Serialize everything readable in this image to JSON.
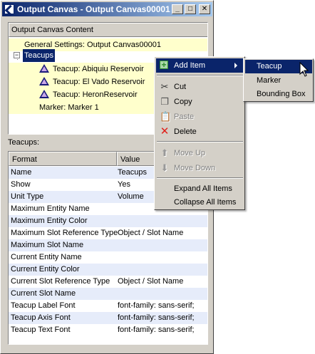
{
  "window": {
    "title": "Output Canvas - Output Canvas00001",
    "minimize_glyph": "_",
    "maximize_glyph": "□",
    "close_glyph": "✕"
  },
  "tree": {
    "header": "Output Canvas Content",
    "general_settings": "General Settings: Output Canvas00001",
    "teacups_node": "Teacups",
    "expander_glyph": "−",
    "teacup_items": [
      "Teacup: Abiquiu Reservoir",
      "Teacup: El Vado Reservoir",
      "Teacup: HeronReservoir"
    ],
    "marker": "Marker: Marker 1"
  },
  "section_label": "Teacups:",
  "table": {
    "col_format": "Format",
    "col_value": "Value",
    "rows": [
      {
        "format": "Name",
        "value": "Teacups"
      },
      {
        "format": "Show",
        "value": "Yes"
      },
      {
        "format": "Unit Type",
        "value": "Volume"
      },
      {
        "format": "Maximum Entity Name",
        "value": ""
      },
      {
        "format": "Maximum Entity Color",
        "value": ""
      },
      {
        "format": "Maximum Slot Reference Type",
        "value": "Object / Slot Name"
      },
      {
        "format": "Maximum Slot Name",
        "value": ""
      },
      {
        "format": "Current Entity Name",
        "value": ""
      },
      {
        "format": "Current Entity Color",
        "value": ""
      },
      {
        "format": "Current Slot Reference Type",
        "value": "Object / Slot Name"
      },
      {
        "format": "Current Slot Name",
        "value": ""
      },
      {
        "format": "Teacup Label Font",
        "value": "font-family: sans-serif;"
      },
      {
        "format": "Teacup Axis Font",
        "value": "font-family: sans-serif;"
      },
      {
        "format": "Teacup Text Font",
        "value": "font-family: sans-serif;"
      }
    ]
  },
  "context_menu": {
    "add_item": "Add Item",
    "cut": "Cut",
    "copy": "Copy",
    "paste": "Paste",
    "delete": "Delete",
    "move_up": "Move Up",
    "move_down": "Move Down",
    "expand_all": "Expand All Items",
    "collapse_all": "Collapse All Items"
  },
  "submenu": {
    "teacup": "Teacup",
    "marker": "Marker",
    "bounding_box": "Bounding Box"
  },
  "colors": {
    "titlebar": "#0a246a",
    "selection": "#0a246a",
    "tree_highlight": "#ffffcc",
    "table_stripe": "#e6ecfa",
    "add_icon": "#2e8b2e",
    "delete_icon": "#e0201a"
  }
}
